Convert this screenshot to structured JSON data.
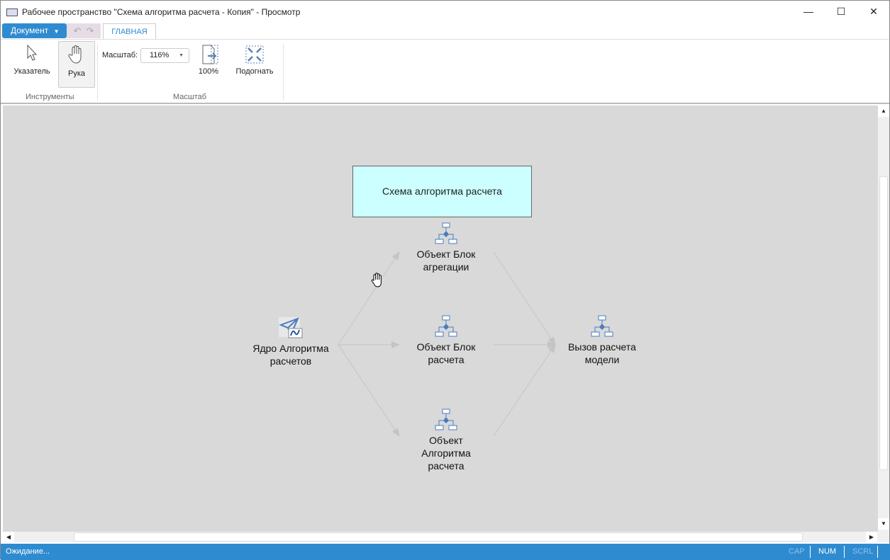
{
  "window": {
    "title": "Рабочее пространство \"Схема алгоритма расчета - Копия\" - Просмотр",
    "minimize": "—",
    "maximize": "☐",
    "close": "✕"
  },
  "menu": {
    "document": "Документ",
    "tab_main": "ГЛАВНАЯ"
  },
  "ribbon": {
    "pointer": "Указатель",
    "hand": "Рука",
    "group_tools": "Инструменты",
    "scale_label": "Масштаб:",
    "scale_value": "116%",
    "zoom100": "100%",
    "fit": "Подогнать",
    "group_scale": "Масштаб"
  },
  "diagram": {
    "title": "Схема алгоритма расчета",
    "nodes": {
      "core": [
        "Ядро Алгоритма",
        "расчетов"
      ],
      "agg": [
        "Объект Блок",
        "агрегации"
      ],
      "calc": [
        "Объект Блок",
        "расчета"
      ],
      "algo": [
        "Объект",
        "Алгоритма",
        "расчета"
      ],
      "call": [
        "Вызов расчета",
        "модели"
      ]
    },
    "colors": {
      "title_fill": "#ccffff",
      "canvas": "#d9d9d9",
      "edge": "#bdbdbd"
    }
  },
  "status": {
    "text": "Ожидание...",
    "cap": "CAP",
    "num": "NUM",
    "scrl": "SCRL"
  }
}
